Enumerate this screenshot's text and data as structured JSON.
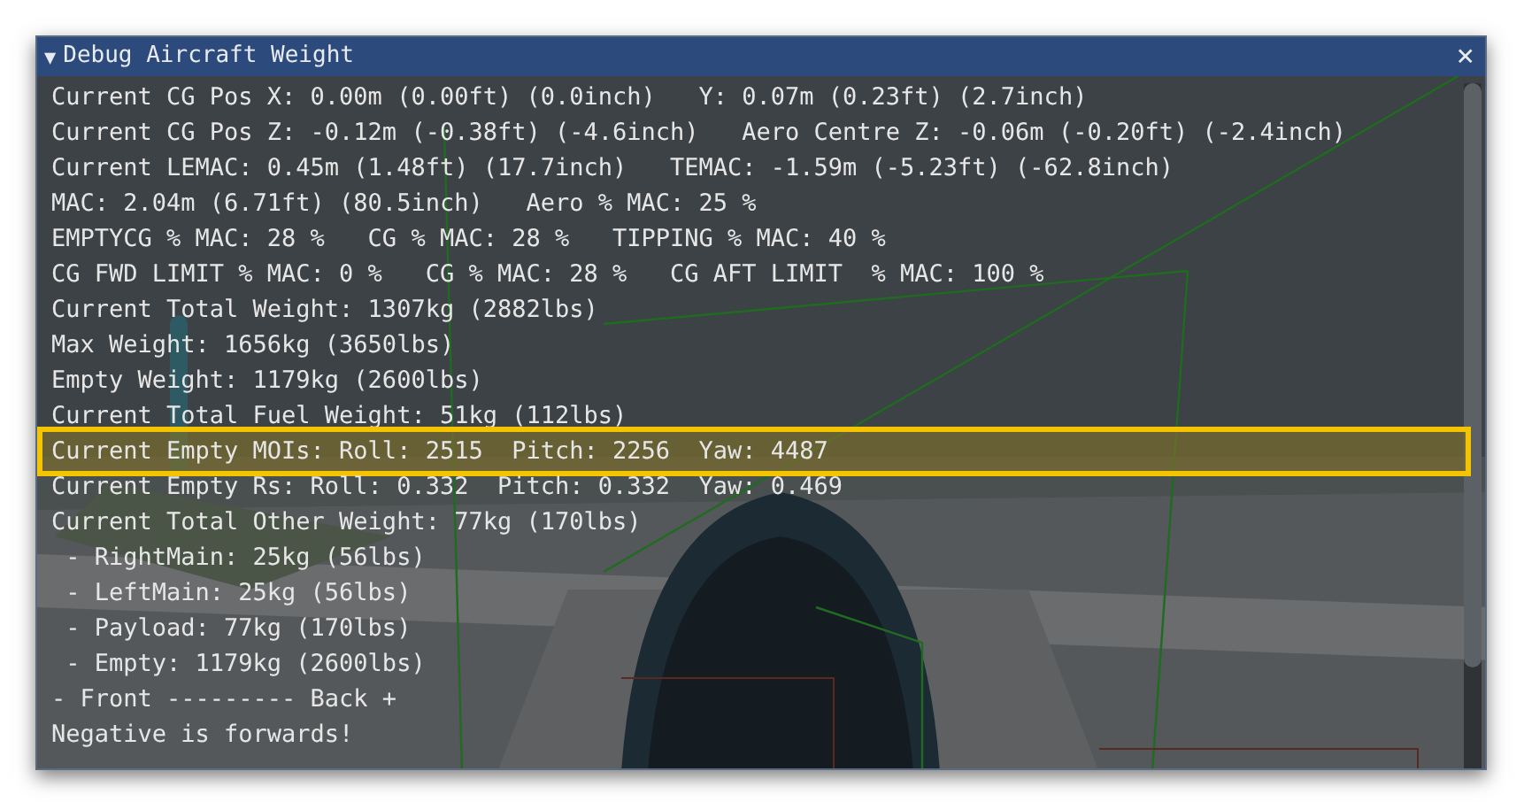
{
  "window": {
    "title": "Debug Aircraft Weight",
    "collapse_icon": "▼",
    "close_icon": "×"
  },
  "lines": [
    {
      "text": "Current CG Pos X: 0.00m (0.00ft) (0.0inch)   Y: 0.07m (0.23ft) (2.7inch)",
      "highlighted": false
    },
    {
      "text": "Current CG Pos Z: -0.12m (-0.38ft) (-4.6inch)   Aero Centre Z: -0.06m (-0.20ft) (-2.4inch)",
      "highlighted": false
    },
    {
      "text": "Current LEMAC: 0.45m (1.48ft) (17.7inch)   TEMAC: -1.59m (-5.23ft) (-62.8inch)",
      "highlighted": false
    },
    {
      "text": "MAC: 2.04m (6.71ft) (80.5inch)   Aero % MAC: 25 %",
      "highlighted": false
    },
    {
      "text": "EMPTYCG % MAC: 28 %   CG % MAC: 28 %   TIPPING % MAC: 40 %",
      "highlighted": false
    },
    {
      "text": "CG FWD LIMIT % MAC: 0 %   CG % MAC: 28 %   CG AFT LIMIT  % MAC: 100 %",
      "highlighted": false
    },
    {
      "text": "Current Total Weight: 1307kg (2882lbs)",
      "highlighted": false
    },
    {
      "text": "Max Weight: 1656kg (3650lbs)",
      "highlighted": false
    },
    {
      "text": "Empty Weight: 1179kg (2600lbs)",
      "highlighted": false
    },
    {
      "text": "Current Total Fuel Weight: 51kg (112lbs)",
      "highlighted": false
    },
    {
      "text": "Current Empty MOIs: Roll: 2515  Pitch: 2256  Yaw: 4487",
      "highlighted": true
    },
    {
      "text": "Current Empty Rs: Roll: 0.332  Pitch: 0.332  Yaw: 0.469",
      "highlighted": false
    },
    {
      "text": "Current Total Other Weight: 77kg (170lbs)",
      "highlighted": false
    },
    {
      "text": " - RightMain: 25kg (56lbs)",
      "highlighted": false
    },
    {
      "text": " - LeftMain: 25kg (56lbs)",
      "highlighted": false
    },
    {
      "text": " - Payload: 77kg (170lbs)",
      "highlighted": false
    },
    {
      "text": " - Empty: 1179kg (2600lbs)",
      "highlighted": false
    },
    {
      "text": "- Front --------- Back +",
      "highlighted": false
    },
    {
      "text": "Negative is forwards!",
      "highlighted": false
    }
  ]
}
